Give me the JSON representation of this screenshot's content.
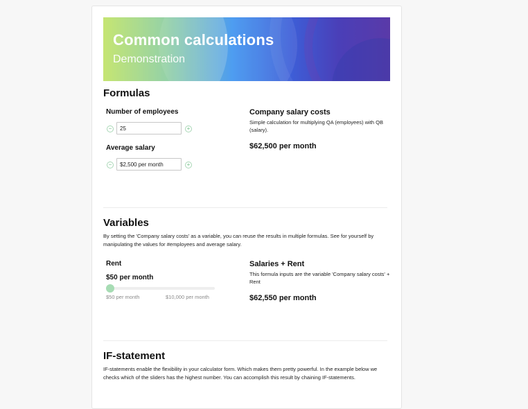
{
  "banner": {
    "title": "Common calculations",
    "subtitle": "Demonstration"
  },
  "formulas": {
    "heading": "Formulas",
    "employees": {
      "label": "Number of employees",
      "value": "25",
      "minus": "−",
      "plus": "+"
    },
    "salary": {
      "label": "Average salary",
      "value": "$2,500 per month",
      "minus": "−",
      "plus": "+"
    },
    "result": {
      "title": "Company salary costs",
      "description": "Simple calculation for multiplying QA (employees) with QB (salary).",
      "value": "$62,500 per month"
    }
  },
  "variables": {
    "heading": "Variables",
    "description": "By setting the 'Company salary costs' as a variable, you can reuse the results in multiple formulas. See for yourself by manipulating the values for #employees and average salary.",
    "rent": {
      "label": "Rent",
      "value": "$50 per month",
      "slider_fraction": 0.0,
      "min_label": "$50 per month",
      "max_label": "$10,000 per month"
    },
    "result": {
      "title": "Salaries + Rent",
      "description": "This formula inputs are the variable 'Company salary costs' + Rent",
      "value": "$62,550 per month"
    }
  },
  "if_statement": {
    "heading": "IF-statement",
    "description": "IF-statements enable the flexibility in your calculator form. Which makes them pretty powerful. In the example below we checks which of the sliders has the highest number. You can accomplish this result by chaining IF-statements."
  },
  "colors": {
    "accent_green": "#a7dcb4",
    "border": "#c7c7c7"
  },
  "icons": {
    "minus": "minus-circle-icon",
    "plus": "plus-circle-icon"
  }
}
